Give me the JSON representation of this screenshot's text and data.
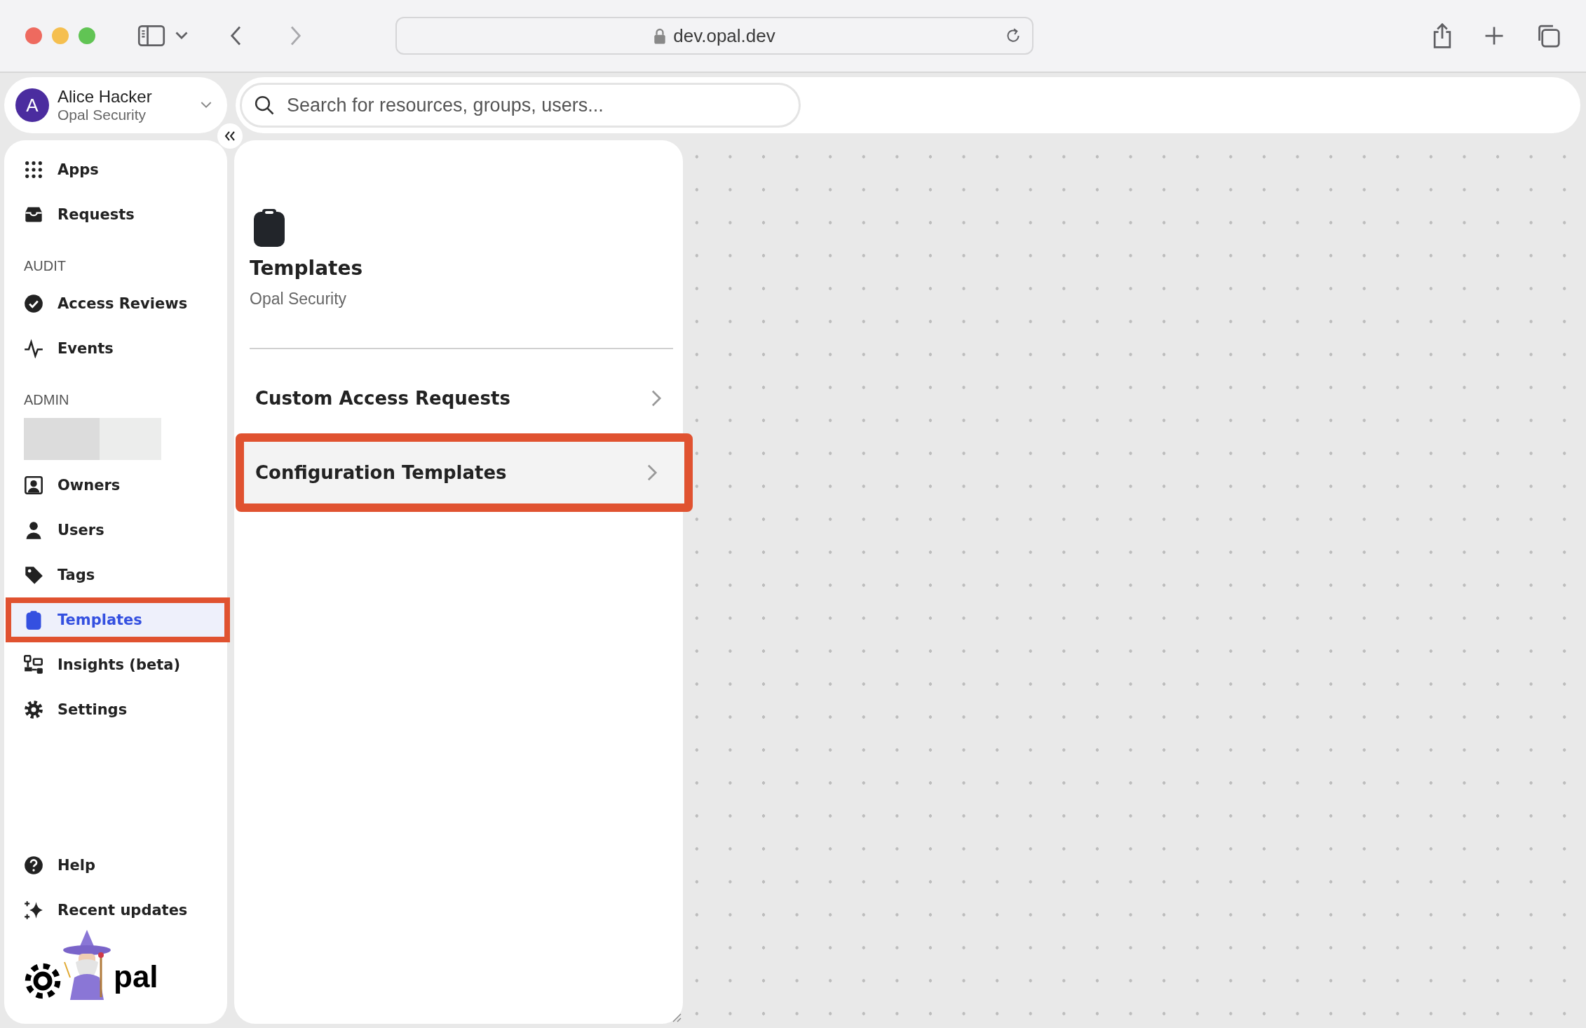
{
  "browser": {
    "url": "dev.opal.dev"
  },
  "account": {
    "initial": "A",
    "name": "Alice Hacker",
    "org": "Opal Security"
  },
  "search": {
    "placeholder": "Search for resources, groups, users..."
  },
  "sidebar": {
    "sections": [
      {
        "items": [
          {
            "kind": "link",
            "label": "Apps",
            "selected": false,
            "highlighted": false
          },
          {
            "kind": "link",
            "label": "Requests",
            "selected": false,
            "highlighted": false
          }
        ]
      },
      {
        "heading": "AUDIT",
        "items": [
          {
            "kind": "link",
            "label": "Access Reviews",
            "selected": false,
            "highlighted": false
          },
          {
            "kind": "link",
            "label": "Events",
            "selected": false,
            "highlighted": false
          }
        ]
      },
      {
        "heading": "ADMIN",
        "items": [
          {
            "kind": "redacted"
          },
          {
            "kind": "link",
            "label": "Owners",
            "selected": false,
            "highlighted": false
          },
          {
            "kind": "link",
            "label": "Users",
            "selected": false,
            "highlighted": false
          },
          {
            "kind": "link",
            "label": "Tags",
            "selected": false,
            "highlighted": false
          },
          {
            "kind": "link",
            "label": "Templates",
            "selected": true,
            "highlighted": true
          },
          {
            "kind": "link",
            "label": "Insights (beta)",
            "selected": false,
            "highlighted": false
          },
          {
            "kind": "link",
            "label": "Settings",
            "selected": false,
            "highlighted": false
          }
        ]
      }
    ],
    "footer": [
      {
        "label": "Help"
      },
      {
        "label": "Recent updates"
      }
    ],
    "logo": {
      "text": "pal"
    }
  },
  "panel": {
    "title": "Templates",
    "subtitle": "Opal Security",
    "rows": [
      {
        "label": "Custom Access Requests",
        "selected": false,
        "highlighted": false
      },
      {
        "label": "Configuration Templates",
        "selected": true,
        "highlighted": true
      }
    ]
  }
}
